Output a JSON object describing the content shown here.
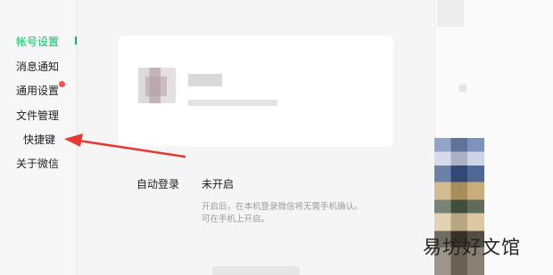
{
  "sidebar": {
    "items": [
      {
        "label": "帐号设置",
        "active": true
      },
      {
        "label": "消息通知"
      },
      {
        "label": "通用设置",
        "badge": "red-dot"
      },
      {
        "label": "文件管理"
      },
      {
        "label": "快捷键"
      },
      {
        "label": "关于微信"
      }
    ]
  },
  "settings": {
    "auto_login": {
      "label": "自动登录",
      "value": "未开启",
      "hint_line1": "开启后，在本机登录微信将无需手机确认。",
      "hint_line2": "可在手机上开启。"
    }
  },
  "watermark": "易坊好文馆",
  "colors": {
    "accent": "#07c160",
    "badge": "#fa5151",
    "annotation_arrow": "#e53935"
  }
}
